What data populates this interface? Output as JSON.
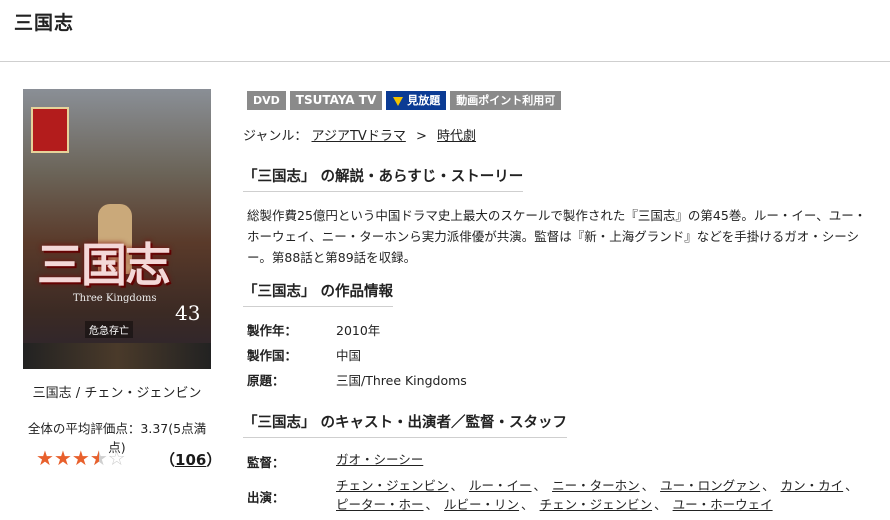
{
  "title": "三国志",
  "cover": {
    "title_text": "三国志",
    "subtitle_text": "Three Kingdoms",
    "volume": "43",
    "episode_text": "危急存亡"
  },
  "caption": "三国志 / チェン・ジェンビン",
  "rating": {
    "text": "全体の平均評価点：3.37(5点満点)",
    "value": 3.37,
    "max": 5,
    "count": "106"
  },
  "badges": [
    "DVD",
    "TSUTAYA TV",
    "見放題",
    "動画ポイント利用可"
  ],
  "genre": {
    "label": "ジャンル：",
    "items": [
      "アジアTVドラマ",
      "時代劇"
    ],
    "separator": ">"
  },
  "sections": {
    "story_heading": "「三国志」 の解説・あらすじ・ストーリー",
    "story_text": "総製作費25億円という中国ドラマ史上最大のスケールで製作された『三国志』の第45巻。ルー・イー、ユー・ホーウェイ、ニー・ターホンら実力派俳優が共演。監督は『新・上海グランド』などを手掛けるガオ・シーシー。第88話と第89話を収録。",
    "info_heading": "「三国志」 の作品情報",
    "info": [
      {
        "key": "製作年：",
        "value": "2010年"
      },
      {
        "key": "製作国：",
        "value": "中国"
      },
      {
        "key": "原題：",
        "value": "三国/Three Kingdoms"
      }
    ],
    "cast_heading": "「三国志」 のキャスト・出演者／監督・スタッフ",
    "director_label": "監督：",
    "director": "ガオ・シーシー",
    "cast_label": "出演：",
    "cast": [
      "チェン・ジェンビン",
      "ルー・イー",
      "ニー・ターホン",
      "ユー・ロングァン",
      "カン・カイ",
      "ピーター・ホー",
      "ルビー・リン",
      "チェン・ジェンビン",
      "ユー・ホーウェイ"
    ]
  },
  "colors": {
    "star": "#e8602c",
    "badge_gray": "#8a8a8a",
    "badge_blue": "#0b3b94"
  }
}
